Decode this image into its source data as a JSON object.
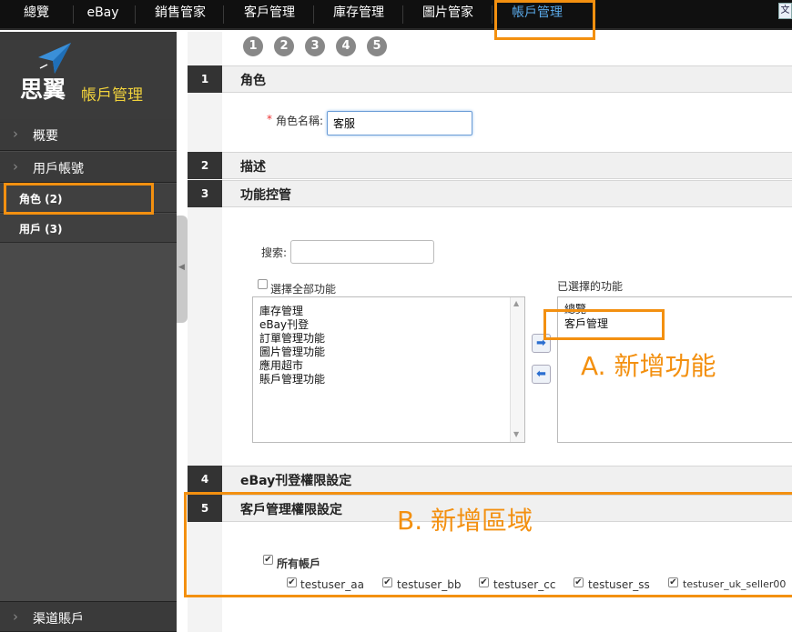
{
  "topnav": {
    "items": [
      "總覽",
      "eBay",
      "銷售管家",
      "客戶管理",
      "庫存管理",
      "圖片管家",
      "帳戶管理"
    ],
    "active_index": 6,
    "active_color": "#5aa9e8",
    "translate_icon_text": "文"
  },
  "sidebar": {
    "logo_name": "思翼",
    "logo_title": "帳戶管理",
    "items": [
      {
        "label": "概要"
      },
      {
        "label": "用戶帳號"
      }
    ],
    "sub_items": [
      {
        "label": "角色 (2)"
      },
      {
        "label": "用戶 (3)"
      }
    ],
    "bottom_item": {
      "label": "渠道賬戶"
    }
  },
  "steps": [
    "1",
    "2",
    "3",
    "4",
    "5"
  ],
  "sections": [
    {
      "num": "1",
      "title": "角色"
    },
    {
      "num": "2",
      "title": "描述"
    },
    {
      "num": "3",
      "title": "功能控管"
    },
    {
      "num": "4",
      "title": "eBay刊登權限設定"
    },
    {
      "num": "5",
      "title": "客戶管理權限設定"
    }
  ],
  "role": {
    "required_mark": "*",
    "label": "角色名稱:",
    "value": "客服"
  },
  "features": {
    "search_label": "搜索:",
    "search_value": "",
    "select_all_label": "選擇全部功能",
    "available": [
      "庫存管理",
      "eBay刊登",
      "訂單管理功能",
      "圖片管理功能",
      "應用超市",
      "賬戶管理功能"
    ],
    "selected_title": "已選擇的功能",
    "selected": [
      "總覽",
      "客戶管理"
    ],
    "move_right_icon": "arrow-right-icon",
    "move_left_icon": "arrow-left-icon"
  },
  "customer_permissions": {
    "all_accounts_label": "所有帳戶",
    "all_accounts_checked": true,
    "accounts": [
      {
        "label": "testuser_aa",
        "checked": true
      },
      {
        "label": "testuser_bb",
        "checked": true
      },
      {
        "label": "testuser_cc",
        "checked": true
      },
      {
        "label": "testuser_ss",
        "checked": true
      },
      {
        "label": "testuser_uk_seller00",
        "checked": true
      }
    ]
  },
  "annotations": {
    "a": "A. 新增功能",
    "b": "B. 新增區域",
    "color": "#f39010"
  }
}
